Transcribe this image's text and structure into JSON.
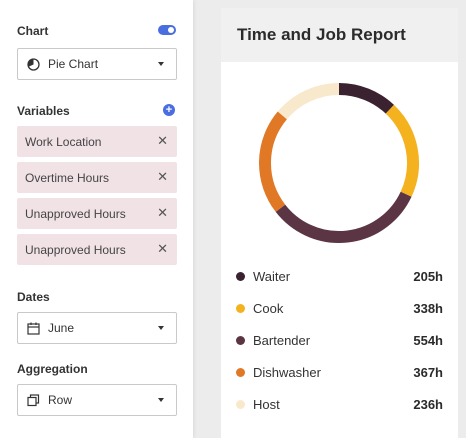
{
  "sidebar": {
    "chart_label": "Chart",
    "chart_select": {
      "value": "Pie Chart",
      "icon": "pie-chart-icon"
    },
    "variables_label": "Variables",
    "variables": [
      {
        "label": "Work Location"
      },
      {
        "label": "Overtime Hours"
      },
      {
        "label": "Unapproved Hours"
      },
      {
        "label": "Unapproved Hours"
      }
    ],
    "dates_label": "Dates",
    "dates_select": {
      "value": "June",
      "icon": "calendar-icon"
    },
    "aggregation_label": "Aggregation",
    "aggregation_select": {
      "value": "Row",
      "icon": "copy-icon"
    },
    "accent_color": "#4a6ee0"
  },
  "report": {
    "title": "Time and Job Report"
  },
  "chart_data": {
    "type": "pie",
    "style": "donut",
    "categories": [
      "Waiter",
      "Cook",
      "Bartender",
      "Dishwasher",
      "Host"
    ],
    "values": [
      205,
      338,
      554,
      367,
      236
    ],
    "value_labels": [
      "205h",
      "338h",
      "554h",
      "367h",
      "236h"
    ],
    "colors": [
      "#3a2230",
      "#f4b21f",
      "#5c3545",
      "#e07826",
      "#f8e9cc"
    ],
    "legend_position": "bottom"
  }
}
